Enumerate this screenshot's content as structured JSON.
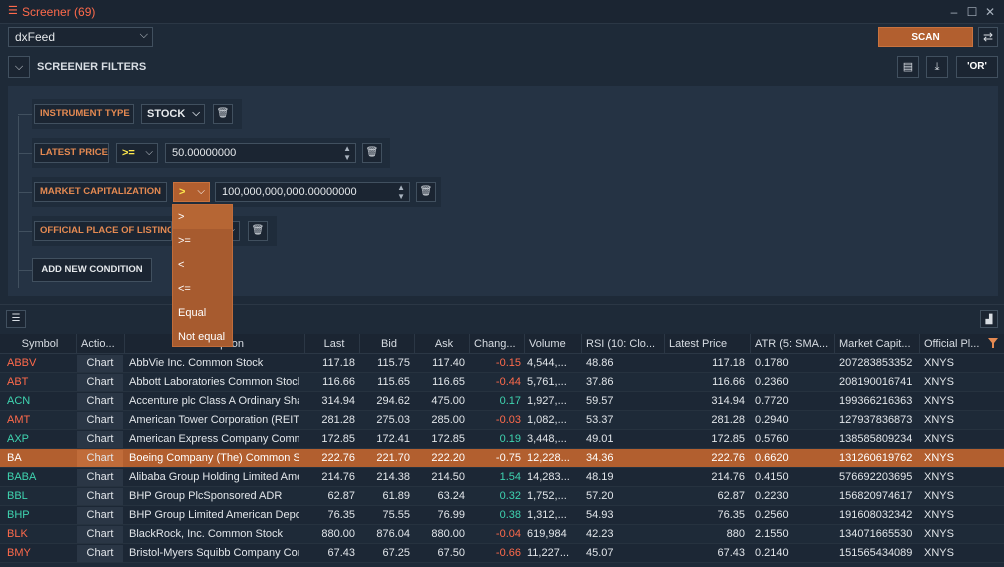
{
  "window": {
    "title": "Screener (69)",
    "menu_icon": "hamburger-icon",
    "controls": [
      "minimize-icon",
      "maximize-icon",
      "close-icon"
    ]
  },
  "toolbar": {
    "source": "dxFeed",
    "scan_label": "SCAN"
  },
  "filters": {
    "title": "SCREENER FILTERS",
    "or_label": "'OR'",
    "add_condition_label": "ADD NEW CONDITION",
    "conditions": [
      {
        "label": "INSTRUMENT TYPE",
        "operator": "STOCK",
        "value": ""
      },
      {
        "label": "LATEST PRICE",
        "operator": ">=",
        "value": "50.00000000"
      },
      {
        "label": "MARKET CAPITALIZATION",
        "operator": ">",
        "value": "100,000,000,000.00000000"
      },
      {
        "label": "OFFICIAL PLACE OF LISTING",
        "operator": "",
        "value": ""
      }
    ],
    "operator_options": [
      ">",
      ">=",
      "<",
      "<=",
      "Equal",
      "Not equal"
    ],
    "selected_option": ">"
  },
  "colors": {
    "accent": "#b25f2f",
    "symbol_red": "#ff6a4b",
    "symbol_green": "#3fd4b0",
    "positive": "#3fd4b0",
    "negative": "#ff6a4b",
    "operator_yellow": "#ffe94d"
  },
  "table": {
    "columns": [
      "Symbol",
      "Actio...",
      "Description",
      "Last",
      "Bid",
      "Ask",
      "Chang...",
      "Volume",
      "RSI (10: Clo...",
      "Latest Price",
      "ATR (5: SMA...",
      "Market Capit...",
      "Official Pl..."
    ],
    "rows": [
      {
        "symbol": "ABBV",
        "trend": "down",
        "action": "Chart",
        "description": "AbbVie Inc. Common Stock",
        "last": "117.18",
        "bid": "115.75",
        "ask": "117.40",
        "change": "-0.15",
        "volume": "4,544,...",
        "rsi": "48.86",
        "latest": "117.18",
        "atr": "0.1780",
        "mcap": "207283853352",
        "place": "XNYS"
      },
      {
        "symbol": "ABT",
        "trend": "down",
        "action": "Chart",
        "description": "Abbott Laboratories Common Stock",
        "last": "116.66",
        "bid": "115.65",
        "ask": "116.65",
        "change": "-0.44",
        "volume": "5,761,...",
        "rsi": "37.86",
        "latest": "116.66",
        "atr": "0.2360",
        "mcap": "208190016741",
        "place": "XNYS"
      },
      {
        "symbol": "ACN",
        "trend": "up",
        "action": "Chart",
        "description": "Accenture plc Class A Ordinary Shares",
        "last": "314.94",
        "bid": "294.62",
        "ask": "475.00",
        "change": "0.17",
        "volume": "1,927,...",
        "rsi": "59.57",
        "latest": "314.94",
        "atr": "0.7720",
        "mcap": "199366216363",
        "place": "XNYS"
      },
      {
        "symbol": "AMT",
        "trend": "down",
        "action": "Chart",
        "description": "American Tower Corporation (REIT)",
        "last": "281.28",
        "bid": "275.03",
        "ask": "285.00",
        "change": "-0.03",
        "volume": "1,082,...",
        "rsi": "53.37",
        "latest": "281.28",
        "atr": "0.2940",
        "mcap": "127937836873",
        "place": "XNYS"
      },
      {
        "symbol": "AXP",
        "trend": "up",
        "action": "Chart",
        "description": "American Express Company Common Stock",
        "last": "172.85",
        "bid": "172.41",
        "ask": "172.85",
        "change": "0.19",
        "volume": "3,448,...",
        "rsi": "49.01",
        "latest": "172.85",
        "atr": "0.5760",
        "mcap": "138585809234",
        "place": "XNYS"
      },
      {
        "symbol": "BA",
        "trend": "down",
        "action": "Chart",
        "description": "Boeing Company (The) Common Stock",
        "last": "222.76",
        "bid": "221.70",
        "ask": "222.20",
        "change": "-0.75",
        "volume": "12,228...",
        "rsi": "34.36",
        "latest": "222.76",
        "atr": "0.6620",
        "mcap": "131260619762",
        "place": "XNYS",
        "highlight": true
      },
      {
        "symbol": "BABA",
        "trend": "up",
        "action": "Chart",
        "description": "Alibaba Group Holding Limited American Depositary Shares",
        "last": "214.76",
        "bid": "214.38",
        "ask": "214.50",
        "change": "1.54",
        "volume": "14,283...",
        "rsi": "48.19",
        "latest": "214.76",
        "atr": "0.4150",
        "mcap": "576692203695",
        "place": "XNYS"
      },
      {
        "symbol": "BBL",
        "trend": "up",
        "action": "Chart",
        "description": "BHP Group PlcSponsored ADR",
        "last": "62.87",
        "bid": "61.89",
        "ask": "63.24",
        "change": "0.32",
        "volume": "1,752,...",
        "rsi": "57.20",
        "latest": "62.87",
        "atr": "0.2230",
        "mcap": "156820974617",
        "place": "XNYS"
      },
      {
        "symbol": "BHP",
        "trend": "up",
        "action": "Chart",
        "description": "BHP Group Limited American Depositary Shares",
        "last": "76.35",
        "bid": "75.55",
        "ask": "76.99",
        "change": "0.38",
        "volume": "1,312,...",
        "rsi": "54.93",
        "latest": "76.35",
        "atr": "0.2560",
        "mcap": "191608032342",
        "place": "XNYS"
      },
      {
        "symbol": "BLK",
        "trend": "down",
        "action": "Chart",
        "description": "BlackRock, Inc. Common Stock",
        "last": "880.00",
        "bid": "876.04",
        "ask": "880.00",
        "change": "-0.04",
        "volume": "619,984",
        "rsi": "42.23",
        "latest": "880",
        "atr": "2.1550",
        "mcap": "134071665530",
        "place": "XNYS"
      },
      {
        "symbol": "BMY",
        "trend": "down",
        "action": "Chart",
        "description": "Bristol-Myers Squibb Company Common Stock",
        "last": "67.43",
        "bid": "67.25",
        "ask": "67.50",
        "change": "-0.66",
        "volume": "11,227...",
        "rsi": "45.07",
        "latest": "67.43",
        "atr": "0.2140",
        "mcap": "151565434089",
        "place": "XNYS"
      }
    ]
  }
}
